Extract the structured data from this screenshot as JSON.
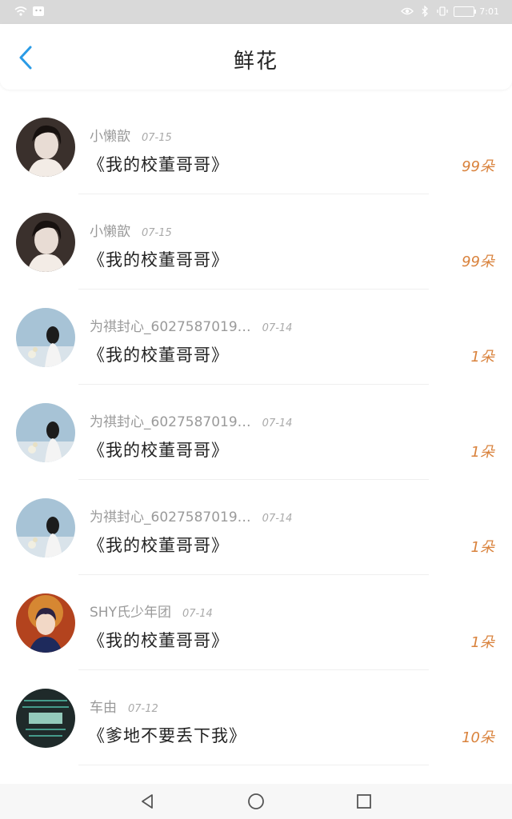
{
  "status_bar": {
    "time": "7:01"
  },
  "header": {
    "title": "鲜花"
  },
  "rows": [
    {
      "user": "小懒歆",
      "date": "07-15",
      "book": "《我的校董哥哥》",
      "count": "99朵",
      "avatar": "a"
    },
    {
      "user": "小懒歆",
      "date": "07-15",
      "book": "《我的校董哥哥》",
      "count": "99朵",
      "avatar": "a"
    },
    {
      "user": "为祺封心_6027587019…",
      "date": "07-14",
      "book": "《我的校董哥哥》",
      "count": "1朵",
      "avatar": "b"
    },
    {
      "user": "为祺封心_6027587019…",
      "date": "07-14",
      "book": "《我的校董哥哥》",
      "count": "1朵",
      "avatar": "b"
    },
    {
      "user": "为祺封心_6027587019…",
      "date": "07-14",
      "book": "《我的校董哥哥》",
      "count": "1朵",
      "avatar": "b"
    },
    {
      "user": "SHY氏少年团",
      "date": "07-14",
      "book": "《我的校董哥哥》",
      "count": "1朵",
      "avatar": "c"
    },
    {
      "user": "车由",
      "date": "07-12",
      "book": "《爹地不要丢下我》",
      "count": "10朵",
      "avatar": "d"
    }
  ],
  "avatar_colors": {
    "a": "#3a302c",
    "b": "#a7c3d6",
    "c": "#b3431e",
    "d": "#1f2a2a"
  },
  "accent_color": "#d9823c"
}
